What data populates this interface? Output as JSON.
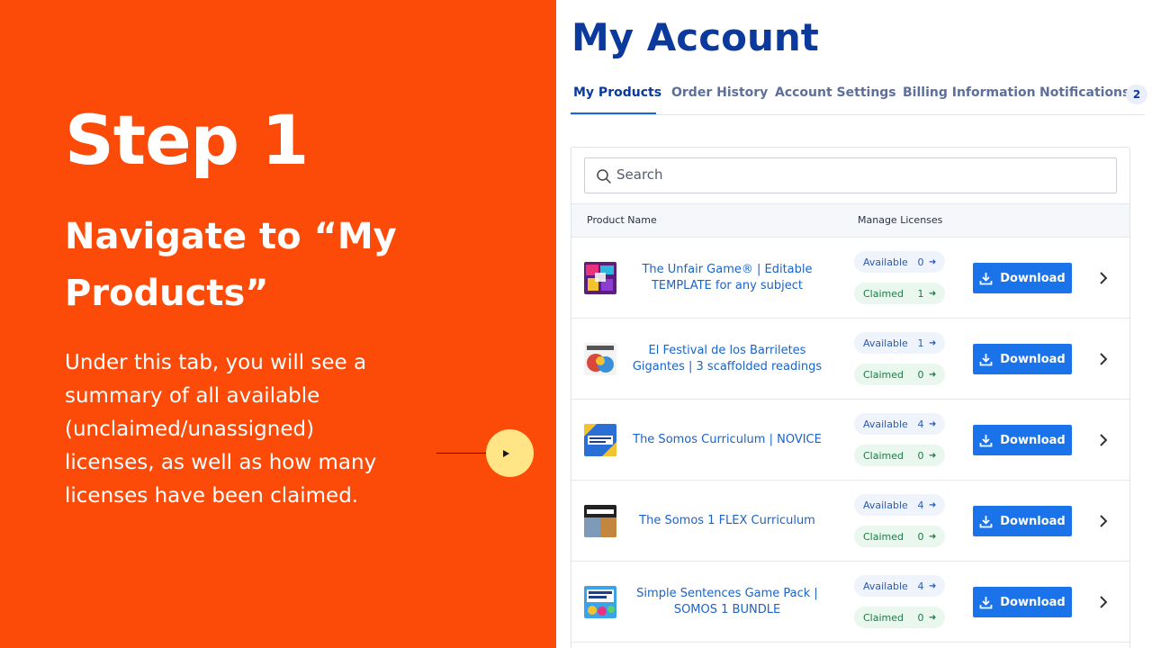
{
  "left": {
    "step": "Step 1",
    "heading": "Navigate to “My Products”",
    "description": "Under this tab, you will see a summary of all available (unclaimed/unassigned) licenses, as well as how many licenses have been claimed."
  },
  "account": {
    "title": "My Account",
    "tabs": [
      {
        "label": "My Products",
        "active": true
      },
      {
        "label": "Order History"
      },
      {
        "label": "Account Settings"
      },
      {
        "label": "Billing Information"
      },
      {
        "label": "Notifications"
      }
    ],
    "notifications_count": "2",
    "search": {
      "placeholder": "Search"
    },
    "columns": {
      "product_name": "Product Name",
      "manage_licenses": "Manage Licenses"
    },
    "available_label": "Available",
    "claimed_label": "Claimed",
    "download_label": "Download",
    "products": [
      {
        "name": "The Unfair Game® | Editable TEMPLATE for any subject",
        "available": "0",
        "claimed": "1"
      },
      {
        "name": "El Festival de los Barriletes Gigantes | 3 scaffolded readings",
        "available": "1",
        "claimed": "0"
      },
      {
        "name": "The Somos Curriculum | NOVICE",
        "available": "4",
        "claimed": "0"
      },
      {
        "name": "The Somos 1 FLEX Curriculum",
        "available": "4",
        "claimed": "0"
      },
      {
        "name": "Simple Sentences Game Pack | SOMOS 1 BUNDLE",
        "available": "4",
        "claimed": "0"
      }
    ]
  },
  "colors": {
    "orange": "#FC4A08",
    "navy": "#0B3A9C",
    "button_blue": "#1a73e8",
    "highlight_yellow": "#FFE586"
  }
}
